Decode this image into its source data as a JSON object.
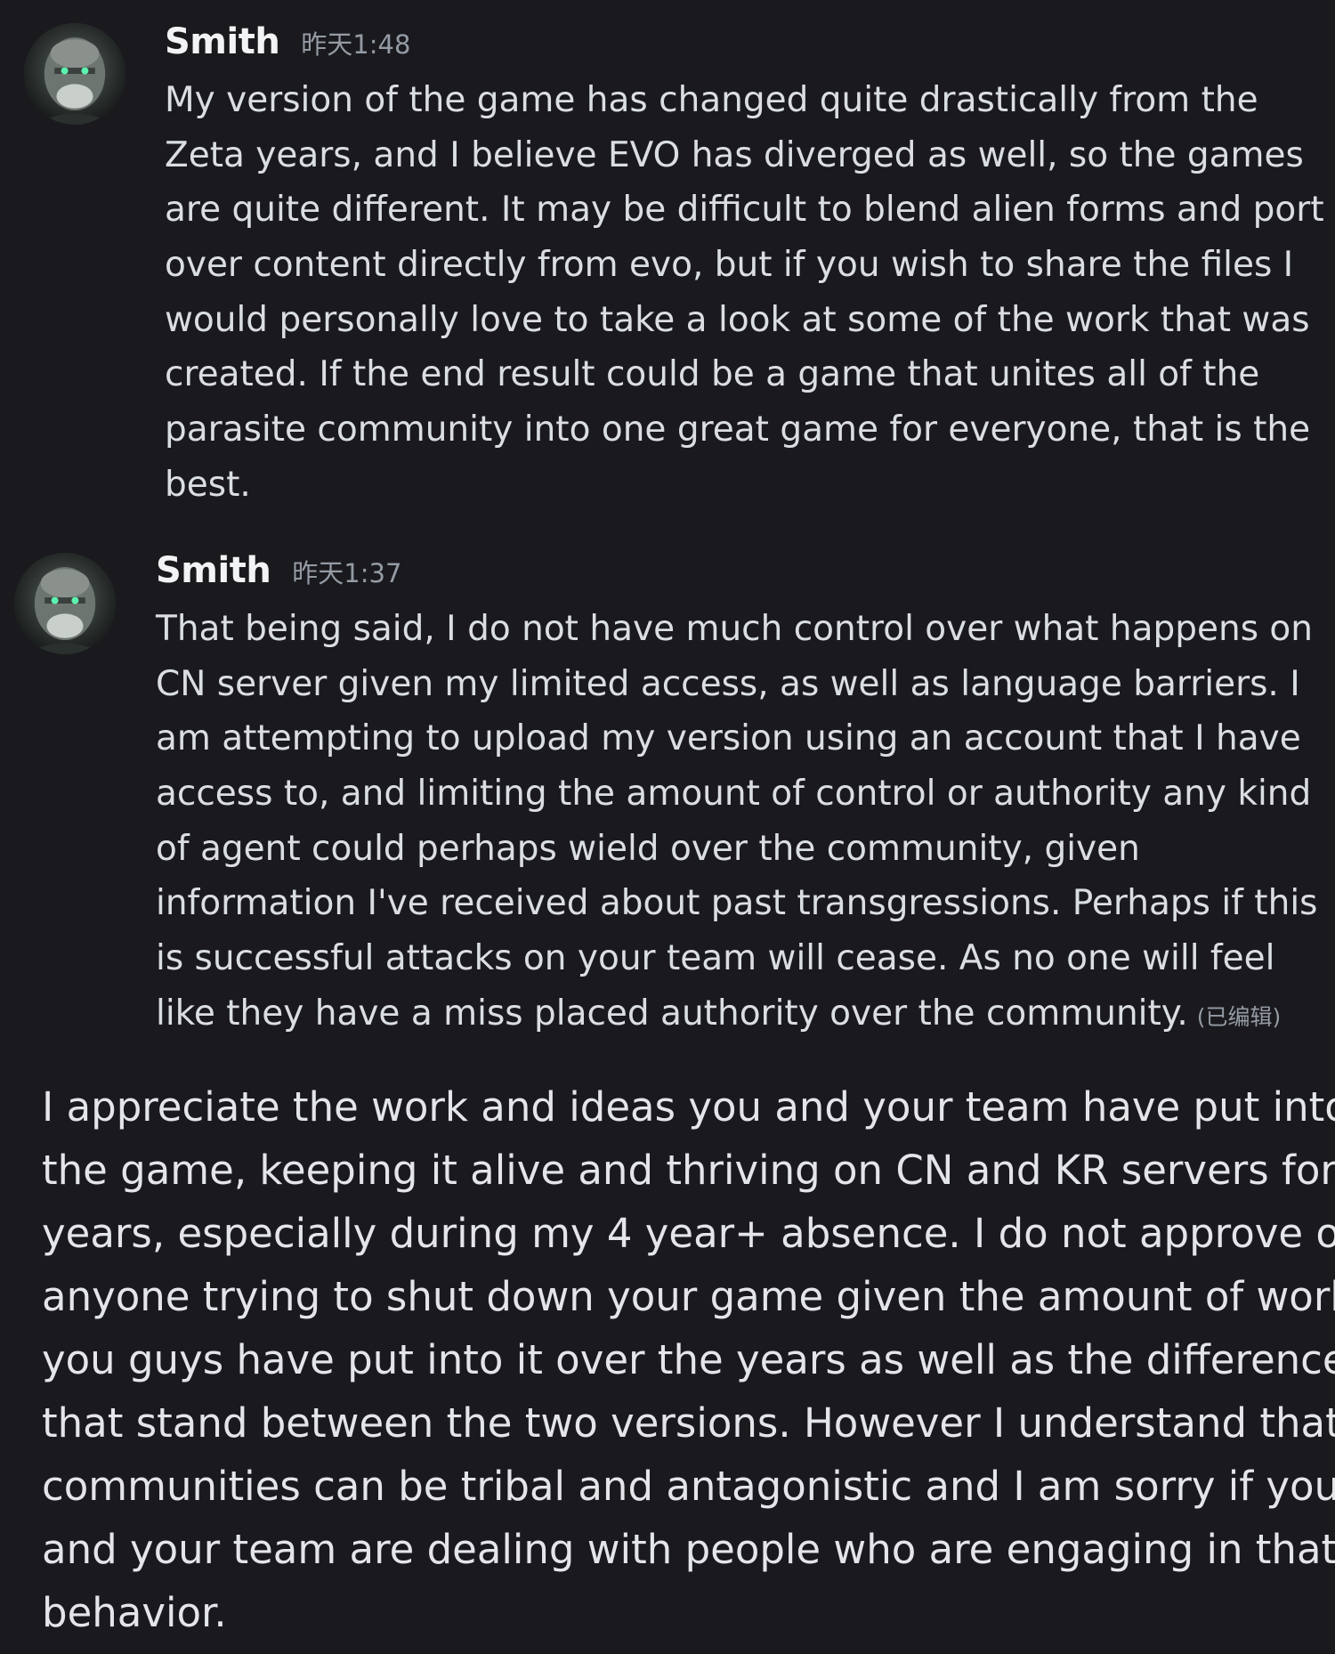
{
  "messages": [
    {
      "username": "Smith",
      "timestamp": "昨天1:48",
      "avatar_icon": "avatar-icon",
      "lines": [
        "My version of the game has changed quite drastically from the",
        "Zeta years, and I believe EVO has diverged as well, so the games",
        "are quite different. It may be difficult to blend alien forms and port",
        "over content directly from evo, but if you wish to share the files I",
        "would personally love to take a look at some of the work that was",
        "created. If the end result could be a game that unites all of the",
        "parasite community into one great game for everyone, that is the",
        "best."
      ]
    },
    {
      "username": "Smith",
      "timestamp": "昨天1:37",
      "avatar_icon": "avatar-icon",
      "lines": [
        "That being said, I do not have much control over what happens on",
        "CN server given my limited access, as well as language barriers. I",
        "am attempting to upload my version using an account that I have",
        "access to, and limiting the amount of control or authority any kind",
        "of agent could perhaps wield over the community, given",
        "information I've received about past transgressions. Perhaps if this",
        "is successful attacks on your team will cease. As no one will feel",
        "like they have a miss placed authority over the community."
      ],
      "edited_label": "(已编辑)"
    }
  ],
  "quote_block": {
    "lines": [
      "I appreciate the work and ideas you and your team have put into",
      "the game, keeping it alive and thriving on CN and KR servers for",
      "years, especially during my 4 year+ absence. I do not approve of",
      "anyone trying to shut down your game given the amount of work",
      "you guys have put into it over the years as well as the differences",
      "that stand between the two versions. However I understand that",
      "communities can be tribal and antagonistic and I am sorry if you",
      "and your team are dealing with people who are engaging in that",
      "behavior."
    ]
  },
  "colors": {
    "background": "#1a1a1e",
    "username": "#f2f3f5",
    "text": "#dbdee1",
    "muted": "#949ba4"
  }
}
